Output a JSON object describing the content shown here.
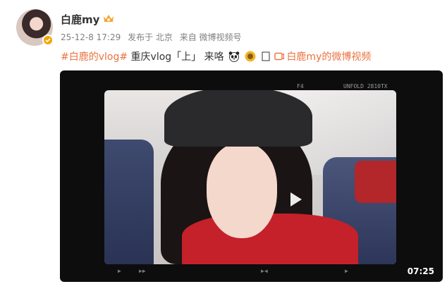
{
  "author": {
    "name": "白鹿my",
    "avatar_icon": "avatar-photo",
    "verified_icon": "crown-verified-icon"
  },
  "meta": {
    "time": "25-12-8 17:29",
    "location": "发布于 北京",
    "source": "来自 微博视频号"
  },
  "post": {
    "hashtag": "#白鹿的vlog#",
    "text": " 重庆vlog「上」 来咯",
    "emoji1": "panda-emoji",
    "emoji2": "sunflower-emoji",
    "emoji3": "box-emoji",
    "video_link_label": "白鹿my的微博视频"
  },
  "video": {
    "duration": "07:25",
    "film_marks_top": [
      "F4",
      "UNFOLD 2810TX"
    ],
    "film_marks_bottom": [
      "▶",
      "▶▶",
      "▶◀",
      "▶"
    ],
    "play_icon": "play-icon"
  },
  "colors": {
    "accent": "#eb7340",
    "text": "#333333",
    "muted": "#808080"
  }
}
